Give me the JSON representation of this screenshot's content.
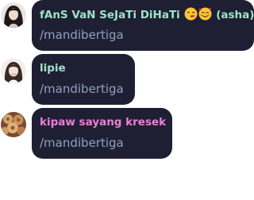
{
  "colors": {
    "bubble_background": "#1f1f33",
    "message_text": "#8fa0bf",
    "username_teal": "#9ee3c8",
    "username_pink": "#ea7fd6"
  },
  "messages": [
    {
      "username": "fAnS VaN SeJaTi DiHaTi",
      "username_suffix": "(asha)",
      "username_color": "#9ee3c8",
      "username_emojis": [
        "face-blowing-kiss-emoji",
        "smiling-face-with-hearts-emoji"
      ],
      "avatar_icon": "user-avatar-icon",
      "text": "/mandibertiga"
    },
    {
      "username": "lipie",
      "username_suffix": "",
      "username_color": "#9ee3c8",
      "username_emojis": [],
      "avatar_icon": "user-avatar-icon",
      "text": "/mandibertiga"
    },
    {
      "username": "kipaw sayang kresek",
      "username_suffix": "",
      "username_color": "#ea7fd6",
      "username_emojis": [],
      "avatar_icon": "user-avatar-icon",
      "text": "/mandibertiga"
    }
  ]
}
